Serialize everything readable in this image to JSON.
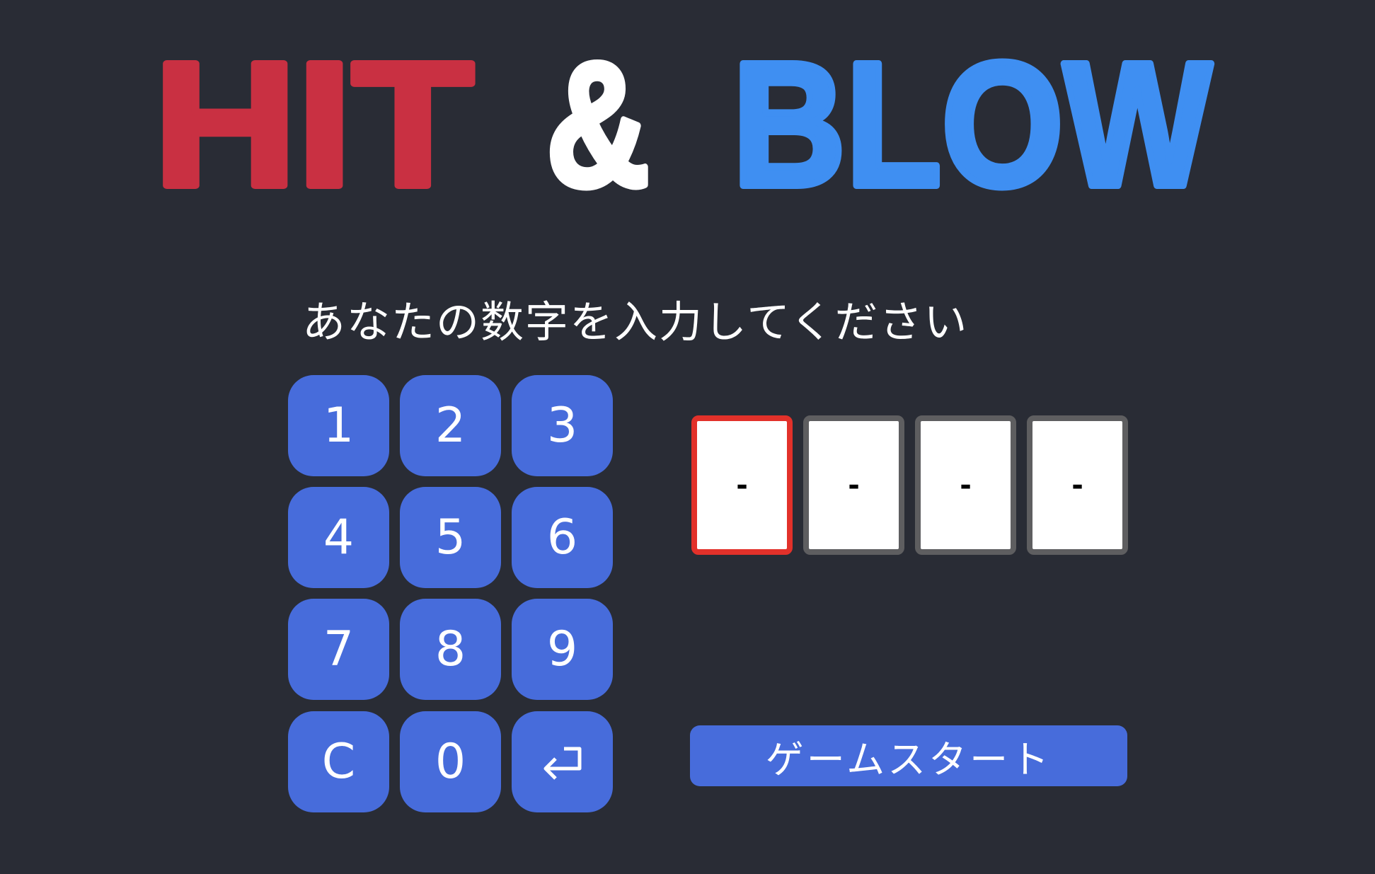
{
  "title": {
    "hit": "HIT",
    "amp": "&",
    "blow": "BLOW",
    "colors": {
      "hit": "#c93042",
      "amp": "#ffffff",
      "blow": "#3f8ff2"
    }
  },
  "prompt": "あなたの数字を入力してください",
  "keypad": {
    "keys": [
      "1",
      "2",
      "3",
      "4",
      "5",
      "6",
      "7",
      "8",
      "9",
      "C",
      "0",
      "⏎"
    ],
    "enter_icon": "return-arrow-icon"
  },
  "slots": {
    "values": [
      "-",
      "-",
      "-",
      "-"
    ],
    "active_index": 0
  },
  "start_button": "ゲームスタート",
  "colors": {
    "background": "#292c35",
    "button": "#476cdb",
    "active_border": "#e2312a",
    "inactive_border": "#5e5e60"
  }
}
